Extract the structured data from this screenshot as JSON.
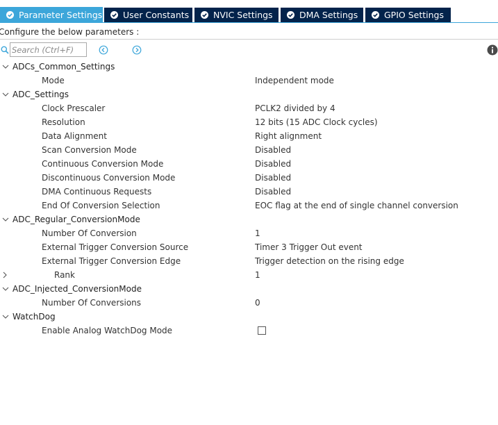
{
  "tabs": [
    {
      "label": "Parameter Settings",
      "active": true
    },
    {
      "label": "User Constants",
      "active": false
    },
    {
      "label": "NVIC Settings",
      "active": false
    },
    {
      "label": "DMA Settings",
      "active": false
    },
    {
      "label": "GPIO Settings",
      "active": false
    }
  ],
  "configure_text": "Configure the below parameters :",
  "search": {
    "placeholder": "Search (Ctrl+F)",
    "value": ""
  },
  "icons": {
    "tab_check": "check-circle-icon",
    "search": "magnifier-icon",
    "previous": "arrow-left-circle-icon",
    "next": "arrow-right-circle-icon",
    "info": "info-icon",
    "expanded": "chevron-down-icon",
    "collapsed": "chevron-right-icon"
  },
  "colors": {
    "active_tab": "#3ca6da",
    "inactive_tab": "#03234b",
    "nav_icon": "#3ca6da",
    "info_icon": "#4a4a4a"
  },
  "groups": [
    {
      "label": "ADCs_Common_Settings",
      "expanded": true,
      "params": [
        {
          "label": "Mode",
          "value": "Independent mode"
        }
      ]
    },
    {
      "label": "ADC_Settings",
      "expanded": true,
      "params": [
        {
          "label": "Clock Prescaler",
          "value": "PCLK2 divided by 4"
        },
        {
          "label": "Resolution",
          "value": "12 bits (15 ADC Clock cycles)"
        },
        {
          "label": "Data Alignment",
          "value": "Right alignment"
        },
        {
          "label": "Scan Conversion Mode",
          "value": "Disabled"
        },
        {
          "label": "Continuous Conversion Mode",
          "value": "Disabled"
        },
        {
          "label": "Discontinuous Conversion Mode",
          "value": "Disabled"
        },
        {
          "label": "DMA Continuous Requests",
          "value": "Disabled"
        },
        {
          "label": "End Of Conversion Selection",
          "value": "EOC flag at the end of single channel conversion"
        }
      ]
    },
    {
      "label": "ADC_Regular_ConversionMode",
      "expanded": true,
      "params": [
        {
          "label": "Number Of Conversion",
          "value": "1"
        },
        {
          "label": "External Trigger Conversion Source",
          "value": "Timer 3 Trigger Out event"
        },
        {
          "label": "External Trigger Conversion Edge",
          "value": "Trigger detection on the rising edge"
        },
        {
          "label": "Rank",
          "value": "1",
          "collapsible": true,
          "expanded": false
        }
      ]
    },
    {
      "label": "ADC_Injected_ConversionMode",
      "expanded": true,
      "params": [
        {
          "label": "Number Of Conversions",
          "value": "0"
        }
      ]
    },
    {
      "label": "WatchDog",
      "expanded": true,
      "params": [
        {
          "label": "Enable Analog WatchDog Mode",
          "checkbox": true,
          "checked": false
        }
      ]
    }
  ]
}
